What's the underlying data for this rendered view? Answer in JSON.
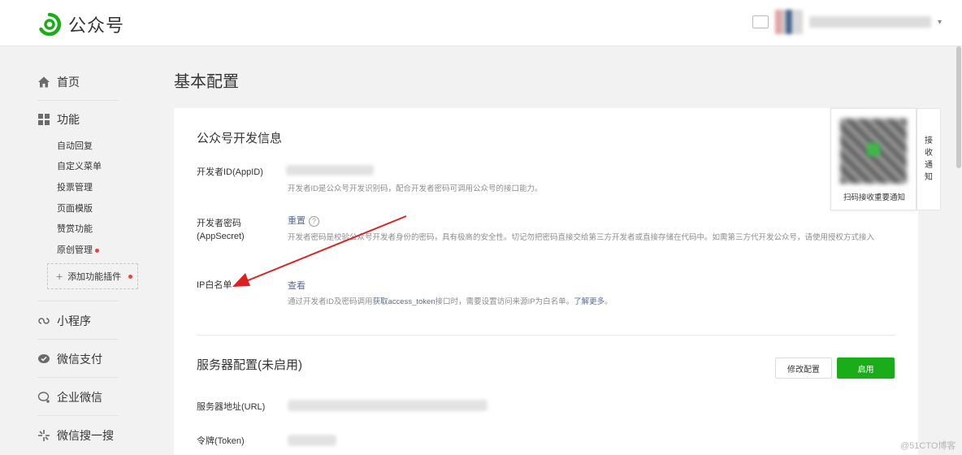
{
  "header": {
    "logo_text": "公众号",
    "brand_color": "#1aad19"
  },
  "sidebar": {
    "home": "首页",
    "function": "功能",
    "function_items": [
      {
        "label": "自动回复"
      },
      {
        "label": "自定义菜单"
      },
      {
        "label": "投票管理"
      },
      {
        "label": "页面模版"
      },
      {
        "label": "赞赏功能"
      },
      {
        "label": "原创管理",
        "badge": true
      }
    ],
    "add_plugin": "添加功能插件",
    "mini_program": "小程序",
    "wechat_pay": "微信支付",
    "enterprise_wechat": "企业微信",
    "wechat_search": "微信搜一搜"
  },
  "main": {
    "page_title": "基本配置",
    "dev_info": {
      "title": "公众号开发信息",
      "appid_label": "开发者ID(AppID)",
      "appid_desc": "开发者ID是公众号开发识别码，配合开发者密码可调用公众号的接口能力。",
      "secret_label_1": "开发者密码",
      "secret_label_2": "(AppSecret)",
      "secret_action": "重置",
      "secret_help_icon": "?",
      "secret_desc": "开发者密码是校验公众号开发者身份的密码，具有极高的安全性。切记勿把密码直接交给第三方开发者或直接存储在代码中。如需第三方代开发公众号，请使用授权方式接入",
      "ip_label": "IP白名单",
      "ip_action": "查看",
      "ip_desc_pre": "通过开发者ID及密码调用",
      "ip_desc_link": "获取access_token",
      "ip_desc_mid": "接口时，需要设置访问来源IP为白名单。",
      "ip_desc_more": "了解更多",
      "ip_desc_end": "。"
    },
    "server": {
      "title": "服务器配置(未启用)",
      "modify_button": "修改配置",
      "enable_button": "启用",
      "url_label": "服务器地址(URL)",
      "token_label": "令牌(Token)"
    }
  },
  "qr_popup": {
    "caption": "扫码接收重要通知",
    "side_chars": [
      "接",
      "收",
      "通",
      "知"
    ]
  },
  "watermark": "@51CTO博客"
}
